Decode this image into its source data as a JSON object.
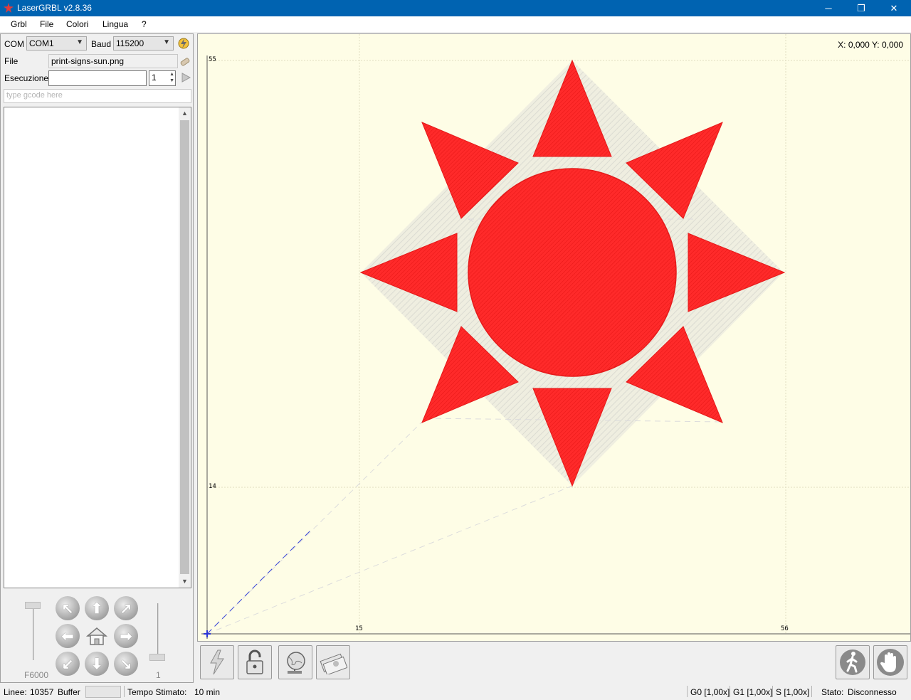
{
  "window": {
    "title": "LaserGRBL v2.8.36",
    "minimize": "─",
    "restore": "❐",
    "close": "✕"
  },
  "menu": [
    "Grbl",
    "File",
    "Colori",
    "Lingua",
    "?"
  ],
  "connection": {
    "com_label": "COM",
    "com_value": "COM1",
    "baud_label": "Baud",
    "baud_value": "115200"
  },
  "file": {
    "label": "File",
    "value": "print-signs-sun.png"
  },
  "execution": {
    "label": "Esecuzione",
    "value": "",
    "passes": "1"
  },
  "gcode": {
    "placeholder": "type gcode here"
  },
  "jog": {
    "speed_label": "F6000",
    "step_label": "1",
    "buttons": [
      "↖",
      "⬆",
      "↗",
      "⬅",
      "",
      "➡",
      "↙",
      "⬇",
      "↘"
    ]
  },
  "canvas": {
    "coordinates": "X: 0,000 Y: 0,000",
    "y_ticks": [
      "55",
      "14"
    ],
    "x_ticks": [
      "15",
      "56"
    ]
  },
  "toolbar": {
    "left": [
      "laser-power-icon",
      "unlock-icon",
      "globe-icon",
      "money-icon"
    ],
    "right": [
      "walking-man-icon",
      "stop-hand-icon"
    ]
  },
  "status": {
    "lines_label": "Linee:",
    "lines_value": "10357",
    "buffer_label": "Buffer",
    "time_label": "Tempo Stimato:",
    "time_value": "10 min",
    "g0": "G0 [1,00x]",
    "g1": "G1 [1,00x]",
    "s": "S [1,00x]",
    "state_label": "Stato:",
    "state_value": "Disconnesso"
  }
}
